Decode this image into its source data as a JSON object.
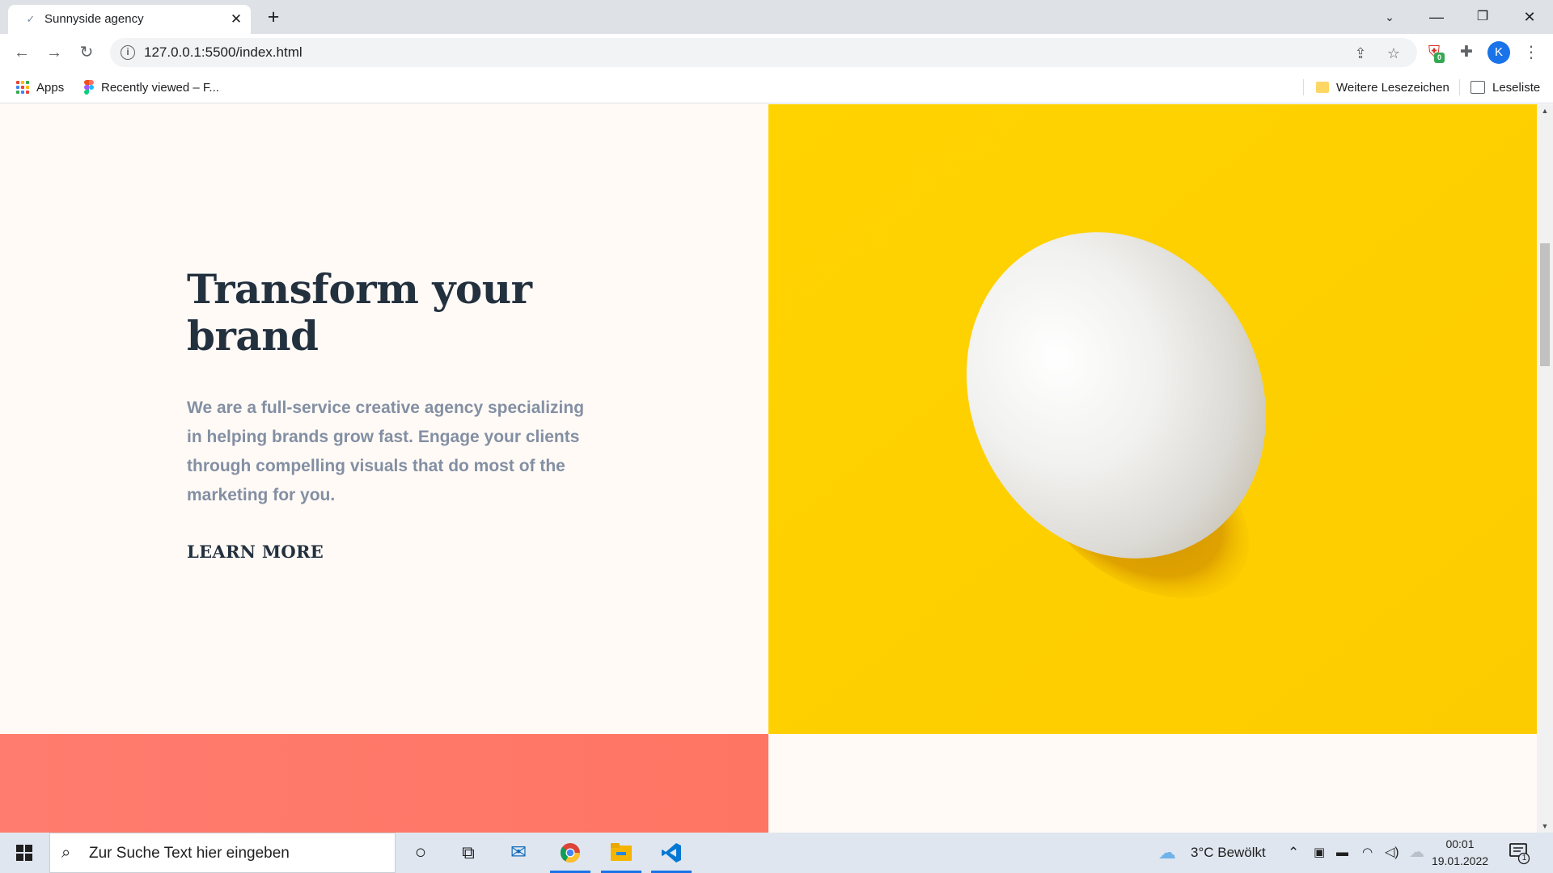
{
  "browser": {
    "tab_title": "Sunnyside agency",
    "tab_favicon": "sunnyside-favicon",
    "url": "127.0.0.1:5500/index.html",
    "extension_badge": "0",
    "profile_initial": "K",
    "bookmarks": [
      {
        "label": "Apps",
        "icon": "apps-grid-icon"
      },
      {
        "label": "Recently viewed – F...",
        "icon": "figma-icon"
      }
    ],
    "other_bookmarks": "Weitere Lesezeichen",
    "reading_list": "Leseliste"
  },
  "hero": {
    "title": "Transform your brand",
    "text": "We are a full-service creative agency specializing in helping brands grow fast. Engage your clients through compelling visuals that do most of the marketing for you.",
    "cta": "LEARN MORE",
    "image_subject": "white egg on yellow background",
    "colors": {
      "yellow": "#fed200",
      "coral": "#ff7564",
      "cream": "#fffaf6",
      "heading": "#23303e",
      "body": "#838fa3"
    }
  },
  "taskbar": {
    "search_placeholder": "Zur Suche Text hier eingeben",
    "weather": "3°C  Bewölkt",
    "time": "00:01",
    "date": "19.01.2022",
    "notification_count": "1",
    "pinned": [
      "cortana-icon",
      "task-view-icon",
      "mail-icon",
      "chrome-icon",
      "file-explorer-icon",
      "vscode-icon"
    ]
  }
}
